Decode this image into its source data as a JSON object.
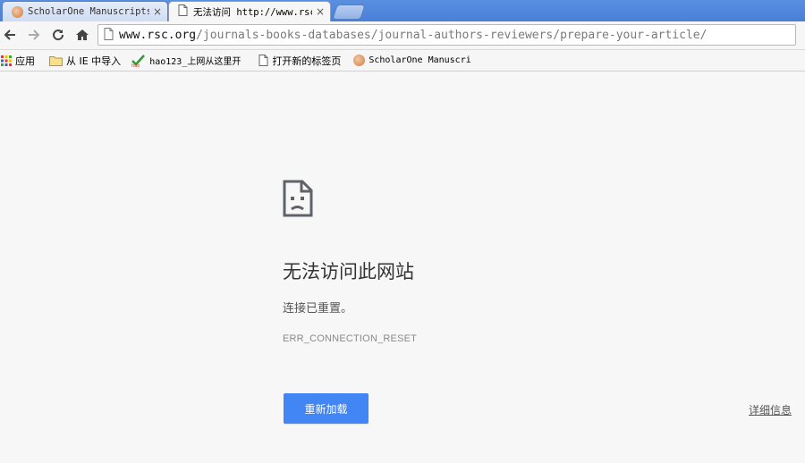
{
  "tabs": [
    {
      "title": "ScholarOne Manuscripts",
      "close": "×"
    },
    {
      "title": "无法访问 http://www.rsc",
      "close": "×"
    }
  ],
  "address_bar": {
    "url_host": "www.rsc.org",
    "url_path": "/journals-books-databases/journal-authors-reviewers/prepare-your-article/"
  },
  "bookmarks": [
    {
      "label": "应用",
      "icon": "apps-grid-icon"
    },
    {
      "label": "从 IE 中导入",
      "icon": "folder-icon"
    },
    {
      "label": "hao123_上网从这里开",
      "icon": "hao123-icon"
    },
    {
      "label": "打开新的标签页",
      "icon": "page-icon"
    },
    {
      "label": "ScholarOne Manuscri",
      "icon": "scholarone-icon"
    }
  ],
  "error": {
    "icon": "sad-page-icon",
    "title": "无法访问此网站",
    "message": "连接已重置。",
    "code": "ERR_CONNECTION_RESET",
    "reload_label": "重新加载",
    "details_label": "详细信息"
  },
  "colors": {
    "accent_button": "#4285f4",
    "tabstrip": "#4f86dc"
  }
}
